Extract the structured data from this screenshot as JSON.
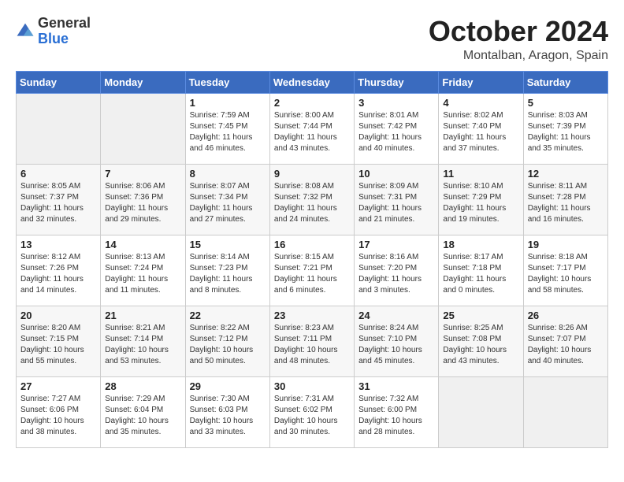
{
  "header": {
    "logo_general": "General",
    "logo_blue": "Blue",
    "month_title": "October 2024",
    "location": "Montalban, Aragon, Spain"
  },
  "days_of_week": [
    "Sunday",
    "Monday",
    "Tuesday",
    "Wednesday",
    "Thursday",
    "Friday",
    "Saturday"
  ],
  "weeks": [
    [
      {
        "day": "",
        "info": ""
      },
      {
        "day": "",
        "info": ""
      },
      {
        "day": "1",
        "info": "Sunrise: 7:59 AM\nSunset: 7:45 PM\nDaylight: 11 hours and 46 minutes."
      },
      {
        "day": "2",
        "info": "Sunrise: 8:00 AM\nSunset: 7:44 PM\nDaylight: 11 hours and 43 minutes."
      },
      {
        "day": "3",
        "info": "Sunrise: 8:01 AM\nSunset: 7:42 PM\nDaylight: 11 hours and 40 minutes."
      },
      {
        "day": "4",
        "info": "Sunrise: 8:02 AM\nSunset: 7:40 PM\nDaylight: 11 hours and 37 minutes."
      },
      {
        "day": "5",
        "info": "Sunrise: 8:03 AM\nSunset: 7:39 PM\nDaylight: 11 hours and 35 minutes."
      }
    ],
    [
      {
        "day": "6",
        "info": "Sunrise: 8:05 AM\nSunset: 7:37 PM\nDaylight: 11 hours and 32 minutes."
      },
      {
        "day": "7",
        "info": "Sunrise: 8:06 AM\nSunset: 7:36 PM\nDaylight: 11 hours and 29 minutes."
      },
      {
        "day": "8",
        "info": "Sunrise: 8:07 AM\nSunset: 7:34 PM\nDaylight: 11 hours and 27 minutes."
      },
      {
        "day": "9",
        "info": "Sunrise: 8:08 AM\nSunset: 7:32 PM\nDaylight: 11 hours and 24 minutes."
      },
      {
        "day": "10",
        "info": "Sunrise: 8:09 AM\nSunset: 7:31 PM\nDaylight: 11 hours and 21 minutes."
      },
      {
        "day": "11",
        "info": "Sunrise: 8:10 AM\nSunset: 7:29 PM\nDaylight: 11 hours and 19 minutes."
      },
      {
        "day": "12",
        "info": "Sunrise: 8:11 AM\nSunset: 7:28 PM\nDaylight: 11 hours and 16 minutes."
      }
    ],
    [
      {
        "day": "13",
        "info": "Sunrise: 8:12 AM\nSunset: 7:26 PM\nDaylight: 11 hours and 14 minutes."
      },
      {
        "day": "14",
        "info": "Sunrise: 8:13 AM\nSunset: 7:24 PM\nDaylight: 11 hours and 11 minutes."
      },
      {
        "day": "15",
        "info": "Sunrise: 8:14 AM\nSunset: 7:23 PM\nDaylight: 11 hours and 8 minutes."
      },
      {
        "day": "16",
        "info": "Sunrise: 8:15 AM\nSunset: 7:21 PM\nDaylight: 11 hours and 6 minutes."
      },
      {
        "day": "17",
        "info": "Sunrise: 8:16 AM\nSunset: 7:20 PM\nDaylight: 11 hours and 3 minutes."
      },
      {
        "day": "18",
        "info": "Sunrise: 8:17 AM\nSunset: 7:18 PM\nDaylight: 11 hours and 0 minutes."
      },
      {
        "day": "19",
        "info": "Sunrise: 8:18 AM\nSunset: 7:17 PM\nDaylight: 10 hours and 58 minutes."
      }
    ],
    [
      {
        "day": "20",
        "info": "Sunrise: 8:20 AM\nSunset: 7:15 PM\nDaylight: 10 hours and 55 minutes."
      },
      {
        "day": "21",
        "info": "Sunrise: 8:21 AM\nSunset: 7:14 PM\nDaylight: 10 hours and 53 minutes."
      },
      {
        "day": "22",
        "info": "Sunrise: 8:22 AM\nSunset: 7:12 PM\nDaylight: 10 hours and 50 minutes."
      },
      {
        "day": "23",
        "info": "Sunrise: 8:23 AM\nSunset: 7:11 PM\nDaylight: 10 hours and 48 minutes."
      },
      {
        "day": "24",
        "info": "Sunrise: 8:24 AM\nSunset: 7:10 PM\nDaylight: 10 hours and 45 minutes."
      },
      {
        "day": "25",
        "info": "Sunrise: 8:25 AM\nSunset: 7:08 PM\nDaylight: 10 hours and 43 minutes."
      },
      {
        "day": "26",
        "info": "Sunrise: 8:26 AM\nSunset: 7:07 PM\nDaylight: 10 hours and 40 minutes."
      }
    ],
    [
      {
        "day": "27",
        "info": "Sunrise: 7:27 AM\nSunset: 6:06 PM\nDaylight: 10 hours and 38 minutes."
      },
      {
        "day": "28",
        "info": "Sunrise: 7:29 AM\nSunset: 6:04 PM\nDaylight: 10 hours and 35 minutes."
      },
      {
        "day": "29",
        "info": "Sunrise: 7:30 AM\nSunset: 6:03 PM\nDaylight: 10 hours and 33 minutes."
      },
      {
        "day": "30",
        "info": "Sunrise: 7:31 AM\nSunset: 6:02 PM\nDaylight: 10 hours and 30 minutes."
      },
      {
        "day": "31",
        "info": "Sunrise: 7:32 AM\nSunset: 6:00 PM\nDaylight: 10 hours and 28 minutes."
      },
      {
        "day": "",
        "info": ""
      },
      {
        "day": "",
        "info": ""
      }
    ]
  ]
}
